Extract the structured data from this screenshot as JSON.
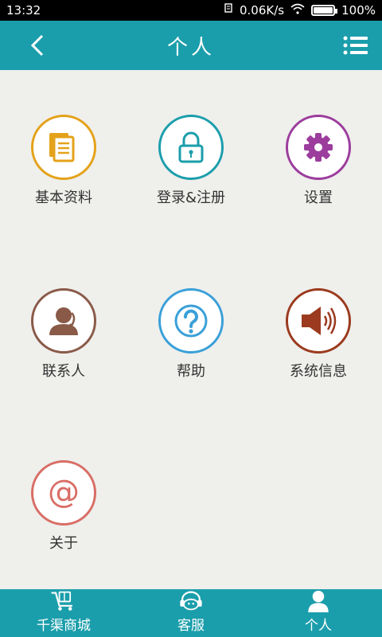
{
  "status_bar": {
    "time": "13:32",
    "network_speed": "0.06K/s",
    "battery": "100%"
  },
  "header": {
    "title": "个人"
  },
  "tiles": [
    {
      "label": "基本资料",
      "icon": "document-stack-icon",
      "color": "#e4a21a"
    },
    {
      "label": "登录&注册",
      "icon": "lock-icon",
      "color": "#1b9eab"
    },
    {
      "label": "设置",
      "icon": "gear-icon",
      "color": "#9c3d9d"
    },
    {
      "label": "联系人",
      "icon": "contact-person-icon",
      "color": "#8a5a48"
    },
    {
      "label": "帮助",
      "icon": "help-question-icon",
      "color": "#3aa0d8"
    },
    {
      "label": "系统信息",
      "icon": "speaker-icon",
      "color": "#9b3a1e"
    },
    {
      "label": "关于",
      "icon": "at-sign-icon",
      "color": "#d86e66"
    }
  ],
  "bottom_nav": {
    "items": [
      {
        "label": "千渠商城",
        "icon": "cart-icon"
      },
      {
        "label": "客服",
        "icon": "headset-icon"
      },
      {
        "label": "个人",
        "icon": "person-icon"
      }
    ]
  },
  "colors": {
    "accent": "#1b9eab",
    "background": "#efefec"
  }
}
